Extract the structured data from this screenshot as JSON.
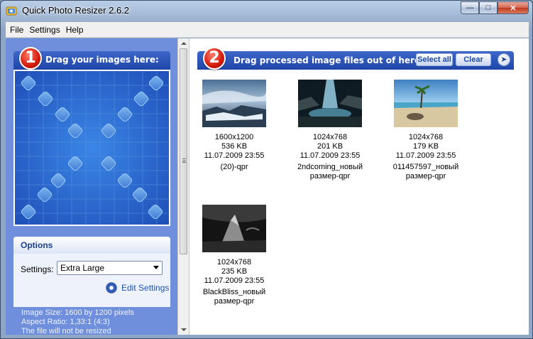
{
  "window": {
    "title": "Quick Photo Resizer 2.6.2"
  },
  "menu": [
    "File",
    "Settings",
    "Help"
  ],
  "left": {
    "step_number": "1",
    "step_title": "Drag your images here:",
    "options_title": "Options",
    "settings_label": "Settings:",
    "settings_value": "Extra Large",
    "edit_settings_label": "Edit Settings",
    "info": [
      "Image Size: 1600 by 1200 pixels",
      "Aspect Ratio: 1,33:1 (4:3)",
      "The file will not be resized"
    ]
  },
  "right": {
    "step_number": "2",
    "step_title": "Drag processed image files out of here:",
    "select_all_label": "Select all",
    "clear_label": "Clear",
    "pin_icon": "pin-icon",
    "items": [
      {
        "dims": "1600x1200",
        "size": "536 KB",
        "date": "11.07.2009 23:55",
        "name1": "(20)-qpr",
        "name2": ""
      },
      {
        "dims": "1024x768",
        "size": "201 KB",
        "date": "11.07.2009 23:55",
        "name1": "2ndcoming_новый",
        "name2": "размер-qpr"
      },
      {
        "dims": "1024x768",
        "size": "179 KB",
        "date": "11.07.2009 23:55",
        "name1": "011457597_новый",
        "name2": "размер-qpr"
      },
      {
        "dims": "1024x768",
        "size": "235 KB",
        "date": "11.07.2009 23:55",
        "name1": "BlackBliss_новый",
        "name2": "размер-qpr"
      }
    ]
  },
  "colors": {
    "header_blue": "#1f45a8",
    "panel_blue": "#6f8fdc",
    "dropzone_blue": "#2c5bc6",
    "badge_red": "#d31a0a"
  }
}
